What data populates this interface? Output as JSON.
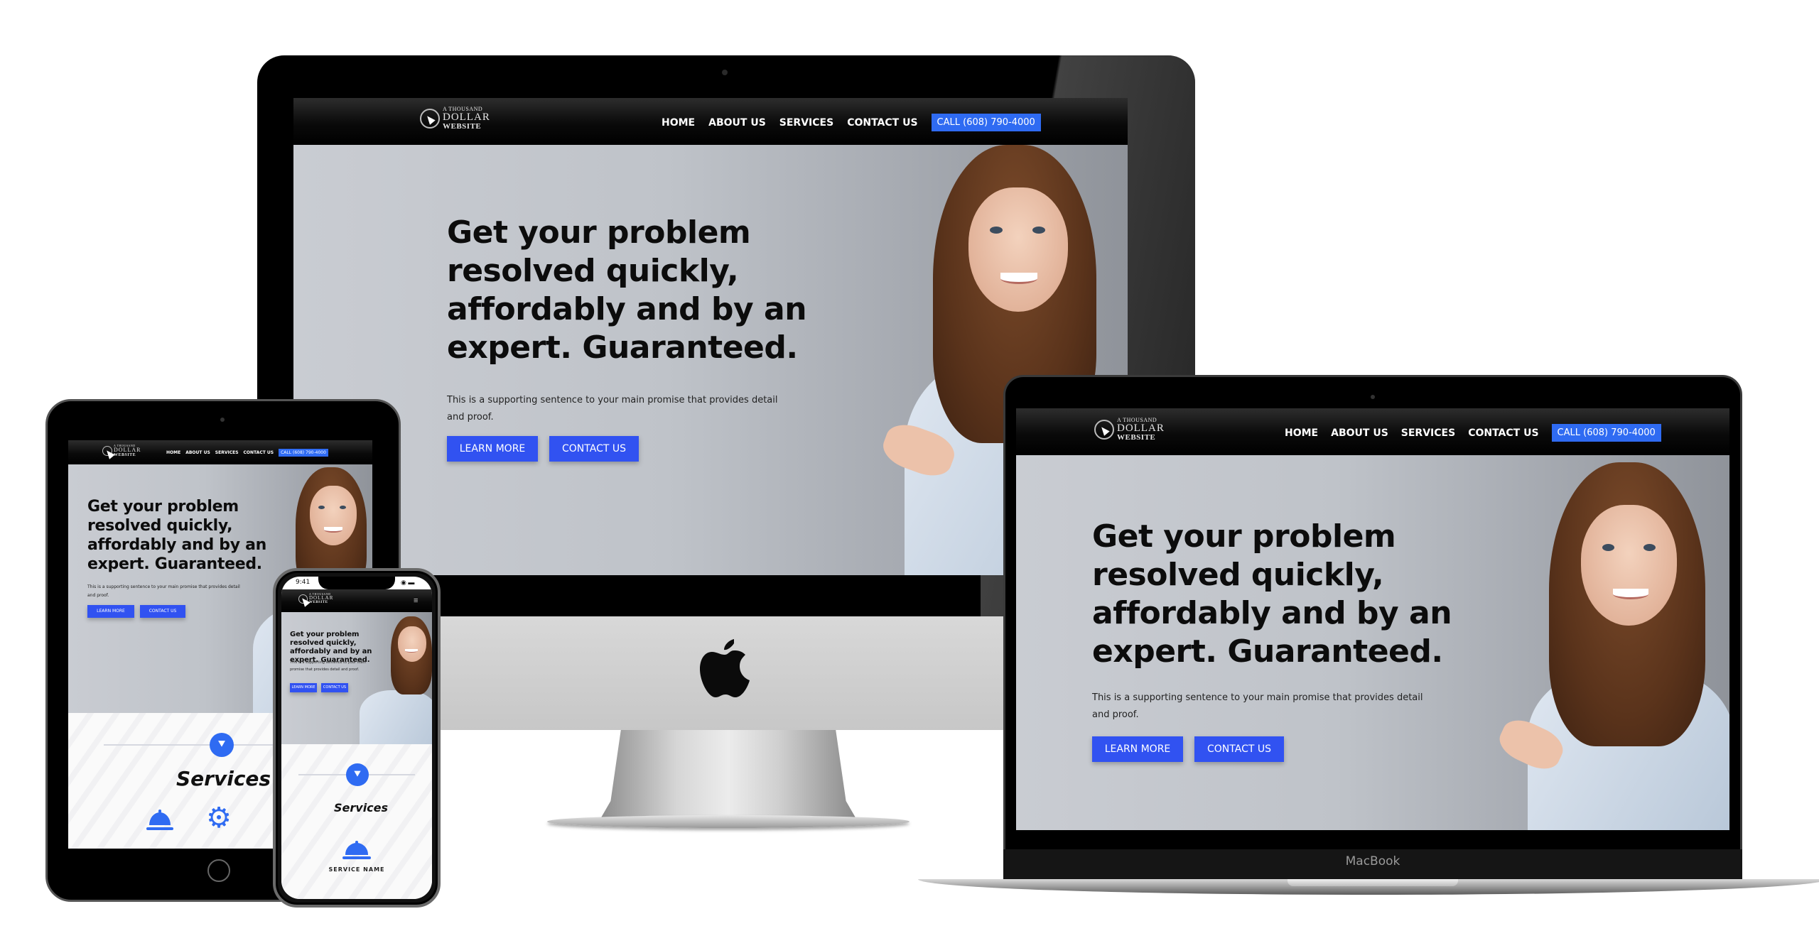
{
  "site": {
    "logo": {
      "line1": "A THOUSAND",
      "line2": "DOLLAR",
      "line3": "WEBSITE"
    },
    "nav": {
      "links": [
        "HOME",
        "ABOUT US",
        "SERVICES",
        "CONTACT US"
      ],
      "call_label": "CALL (608) 790-4000"
    },
    "hero": {
      "title_lines": [
        "Get your problem",
        "resolved quickly,",
        "affordably and by an",
        "expert. Guaranteed."
      ],
      "title_full": "Get your problem resolved quickly, affordably and by an expert. Guaranteed.",
      "subtitle_line1": "This is a supporting sentence to your main promise that provides detail",
      "subtitle_line2": "and proof.",
      "subtitle_full": "This is a supporting sentence to your main promise that provides detail and proof.",
      "learn_more_label": "LEARN MORE",
      "contact_label": "CONTACT US"
    },
    "services": {
      "badge_icon": "chevrons-down-icon",
      "title": "Services",
      "service_name": "SERVICE NAME"
    }
  },
  "devices": {
    "laptop_brand": "MacBook",
    "phone_time": "9:41"
  },
  "colors": {
    "accent_blue": "#3152f1",
    "call_blue": "#2f6bf2",
    "nav_black": "#0a0a0a"
  }
}
